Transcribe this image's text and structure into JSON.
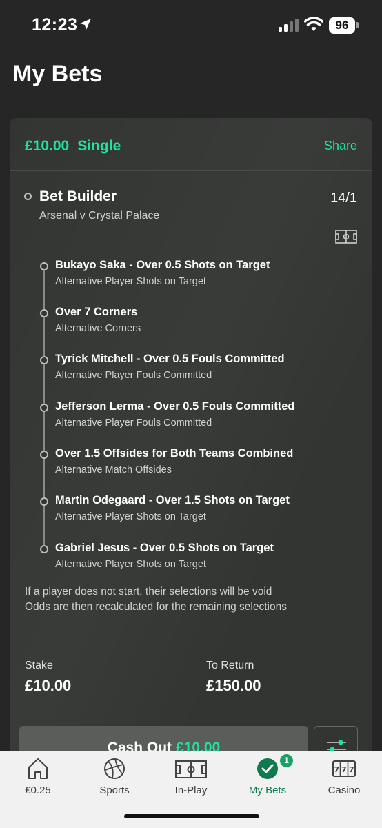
{
  "status_bar": {
    "time": "12:23",
    "battery": "96"
  },
  "page": {
    "title": "My Bets"
  },
  "bet": {
    "stake_amount": "£10.00",
    "bet_type": "Single",
    "share_label": "Share",
    "builder_title": "Bet Builder",
    "odds": "14/1",
    "match": "Arsenal v Crystal Palace",
    "legs": [
      {
        "title": "Bukayo Saka - Over 0.5 Shots on Target",
        "market": "Alternative Player Shots on Target"
      },
      {
        "title": "Over 7 Corners",
        "market": "Alternative Corners"
      },
      {
        "title": "Tyrick Mitchell - Over 0.5 Fouls Committed",
        "market": "Alternative Player Fouls Committed"
      },
      {
        "title": "Jefferson Lerma - Over 0.5 Fouls Committed",
        "market": "Alternative Player Fouls Committed"
      },
      {
        "title": "Over 1.5 Offsides for Both Teams Combined",
        "market": "Alternative Match Offsides"
      },
      {
        "title": "Martin Odegaard - Over 1.5 Shots on Target",
        "market": "Alternative Player Shots on Target"
      },
      {
        "title": "Gabriel Jesus - Over 0.5 Shots on Target",
        "market": "Alternative Player Shots on Target"
      }
    ],
    "void_note_line1": "If a player does not start, their selections will be void",
    "void_note_line2": "Odds are then recalculated for the remaining selections",
    "stake_label": "Stake",
    "stake_value": "£10.00",
    "return_label": "To Return",
    "return_value": "£150.00",
    "cashout_label": "Cash Out",
    "cashout_amount": "£10.00"
  },
  "bottom_nav": {
    "items": [
      {
        "label": "£0.25",
        "icon": "home-icon"
      },
      {
        "label": "Sports",
        "icon": "football-icon"
      },
      {
        "label": "In-Play",
        "icon": "pitch-icon"
      },
      {
        "label": "My Bets",
        "icon": "check-circle-icon",
        "badge": "1",
        "active": true
      },
      {
        "label": "Casino",
        "icon": "slot-machine-icon"
      }
    ]
  },
  "colors": {
    "accent": "#1ee39a",
    "active_nav": "#0e7a4e",
    "background": "#262626",
    "card": "#333533"
  }
}
